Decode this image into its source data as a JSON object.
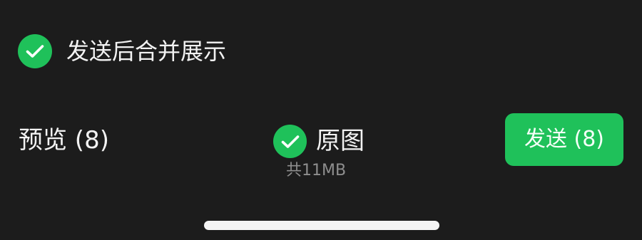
{
  "options": {
    "merge_display": {
      "label": "发送后合并展示",
      "checked": true,
      "icon": "check-circle-icon"
    }
  },
  "footer": {
    "preview_label": "预览 (8)",
    "original": {
      "label": "原图",
      "checked": true,
      "icon": "check-circle-icon",
      "size_text": "共11MB"
    },
    "send_label": "发送 (8)"
  },
  "colors": {
    "accent": "#1fc15a",
    "background": "#1c1c1c",
    "text": "#f2f2f2",
    "secondary_text": "#8e8e8e"
  }
}
